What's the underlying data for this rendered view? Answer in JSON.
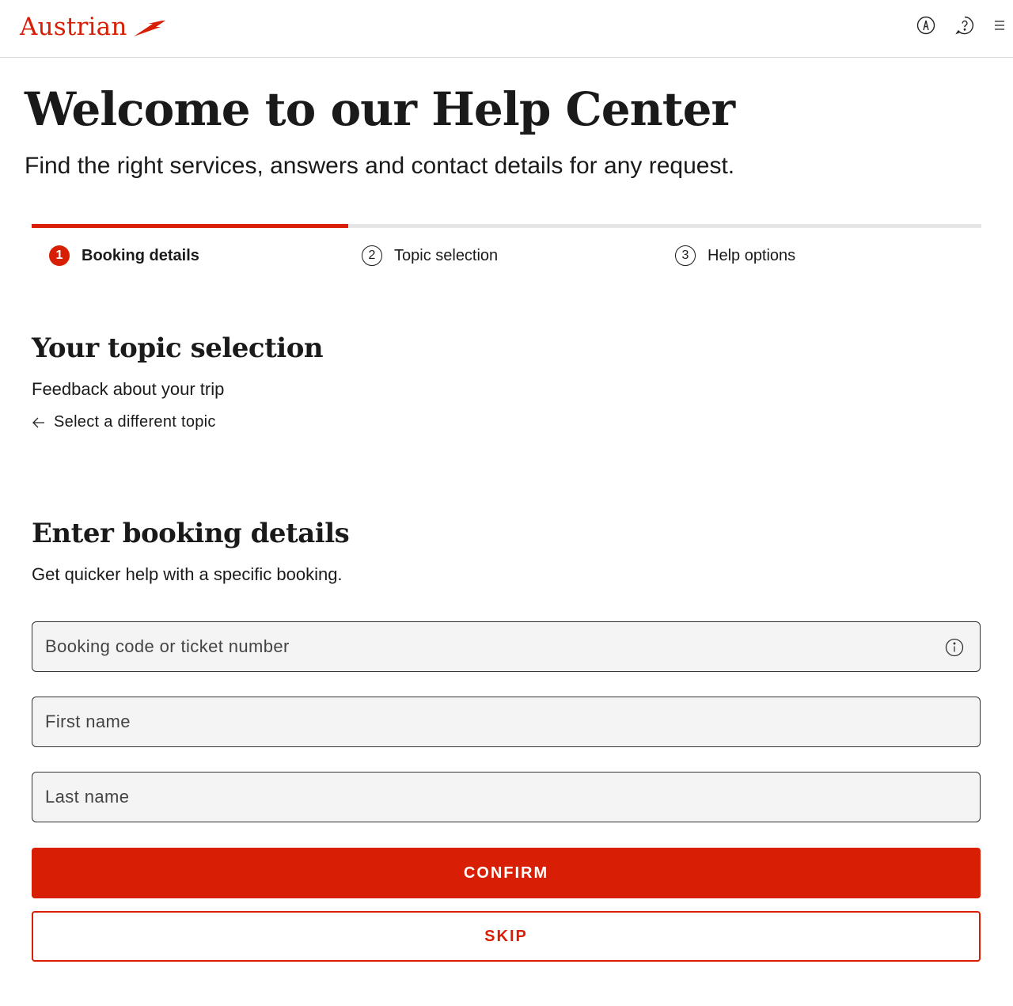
{
  "header": {
    "logo_text": "Austrian",
    "brand_color": "#d81e05",
    "icons": [
      "account-icon",
      "help-icon",
      "menu-icon"
    ]
  },
  "hero": {
    "title": "Welcome to our Help Center",
    "subtitle": "Find the right services, answers and contact details for any request."
  },
  "stepper": {
    "progress_fraction": 0.3333,
    "steps": [
      {
        "number": "1",
        "label": "Booking details",
        "active": true
      },
      {
        "number": "2",
        "label": "Topic selection",
        "active": false
      },
      {
        "number": "3",
        "label": "Help options",
        "active": false
      }
    ]
  },
  "topic": {
    "title": "Your topic selection",
    "selected": "Feedback about your trip",
    "change_link": "Select a different topic"
  },
  "booking": {
    "title": "Enter booking details",
    "subtitle": "Get quicker help with a specific booking.",
    "fields": {
      "code": {
        "placeholder": "Booking code or ticket number",
        "value": ""
      },
      "first_name": {
        "placeholder": "First name",
        "value": ""
      },
      "last_name": {
        "placeholder": "Last name",
        "value": ""
      }
    },
    "confirm_label": "CONFIRM",
    "skip_label": "SKIP"
  }
}
